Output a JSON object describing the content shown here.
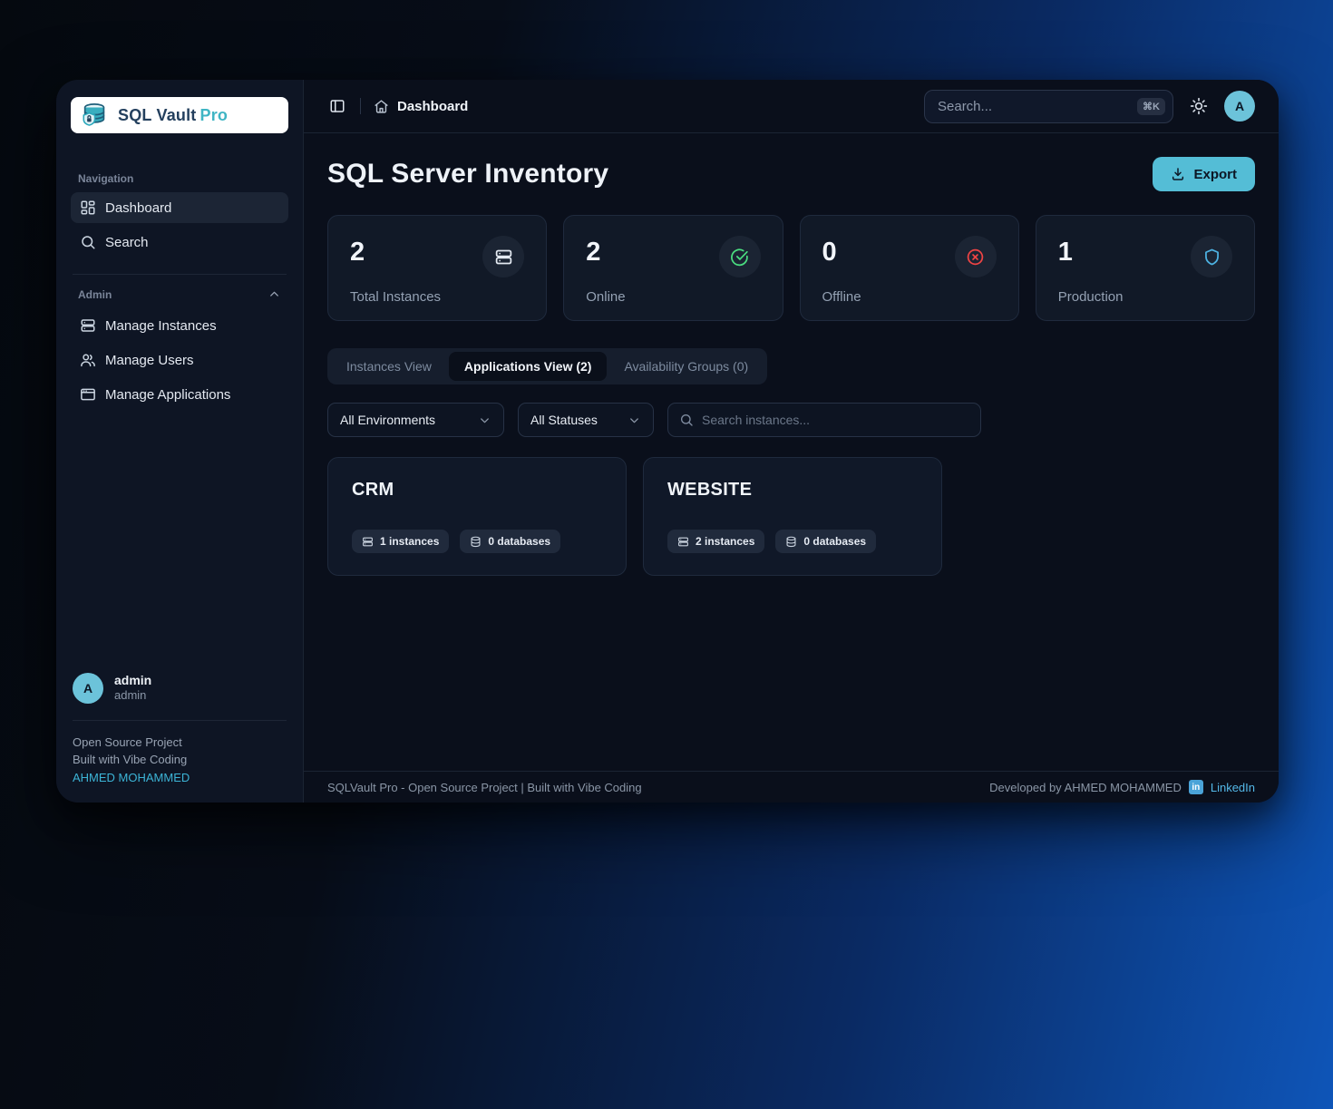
{
  "colors": {
    "accent_cyan": "#54bdd6",
    "online_green": "#4ade80",
    "offline_red": "#ef4444",
    "production_blue": "#4db2e2",
    "link_cyan": "#3cb4d6",
    "linkedin_blue": "#54b8e8"
  },
  "sidebar": {
    "brand": "SQL Vault",
    "brand_suffix": "Pro",
    "nav_label": "Navigation",
    "items": [
      {
        "label": "Dashboard"
      },
      {
        "label": "Search"
      }
    ],
    "admin_label": "Admin",
    "admin_items": [
      {
        "label": "Manage Instances"
      },
      {
        "label": "Manage Users"
      },
      {
        "label": "Manage Applications"
      }
    ],
    "user": {
      "initial": "A",
      "name": "admin",
      "role": "admin"
    },
    "footer_line1": "Open Source Project",
    "footer_line2": "Built with Vibe Coding",
    "footer_link": "AHMED MOHAMMED"
  },
  "header": {
    "breadcrumb": "Dashboard",
    "search_placeholder": "Search...",
    "kbd": "⌘K",
    "avatar_initial": "A"
  },
  "main": {
    "title": "SQL Server Inventory",
    "export_label": "Export",
    "stats": [
      {
        "value": "2",
        "label": "Total Instances"
      },
      {
        "value": "2",
        "label": "Online"
      },
      {
        "value": "0",
        "label": "Offline"
      },
      {
        "value": "1",
        "label": "Production"
      }
    ],
    "tabs": [
      {
        "label": "Instances View"
      },
      {
        "label": "Applications View (2)"
      },
      {
        "label": "Availability Groups (0)"
      }
    ],
    "filters": {
      "environment": "All Environments",
      "status": "All Statuses",
      "search_placeholder": "Search instances..."
    },
    "applications": [
      {
        "name": "CRM",
        "instances_badge": "1 instances",
        "databases_badge": "0 databases"
      },
      {
        "name": "WEBSITE",
        "instances_badge": "2 instances",
        "databases_badge": "0 databases"
      }
    ]
  },
  "footer": {
    "left": "SQLVault Pro - Open Source Project | Built with Vibe Coding",
    "developed_by": "Developed by AHMED MOHAMMED",
    "linkedin_icon": "in",
    "linkedin_label": "LinkedIn"
  }
}
